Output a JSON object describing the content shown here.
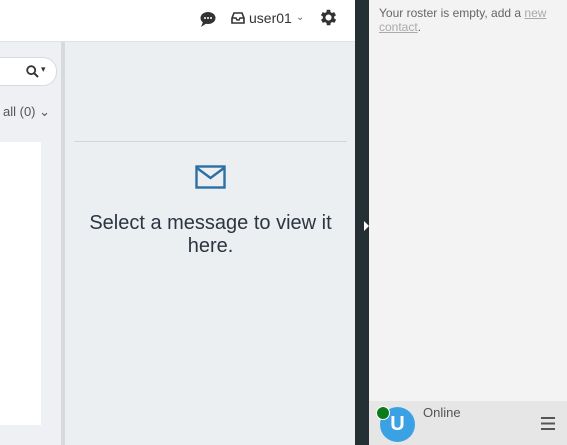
{
  "header": {
    "chat_icon": "chat-bubble-icon",
    "inbox_icon": "inbox-icon",
    "username": "user01",
    "user_caret": "⌄",
    "settings_icon": "gear-icon"
  },
  "list": {
    "search_icon": "search-icon",
    "search_caret": "▾",
    "filter_label": "all (0)",
    "filter_caret": "⌄"
  },
  "preview": {
    "icon": "envelope-icon",
    "message": "Select a message to view it here."
  },
  "roster": {
    "empty_text": "Your roster is empty, add a ",
    "empty_link": "new contact",
    "empty_suffix": ".",
    "avatar_letter": "U",
    "status": "Online",
    "status_color": "#0c7a1a",
    "avatar_color": "#3aa2e4",
    "menu_icon": "hamburger-menu-icon"
  },
  "colors": {
    "accent": "#2d6fa3",
    "divider": "#243033"
  }
}
